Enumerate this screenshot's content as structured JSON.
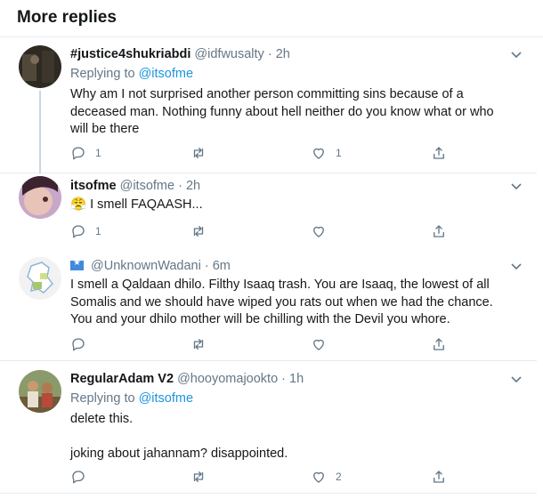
{
  "header": {
    "title": "More replies"
  },
  "replies": [
    {
      "name": "#justice4shukriabdi",
      "handle": "@idfwusalty",
      "time": "2h",
      "replying_prefix": "Replying to",
      "replying_to": "@itsofme",
      "text_lines": [
        "Why am I not surprised another person committing sins because of a",
        "deceased man. Nothing funny about hell neither do you know what or who",
        "will be there"
      ],
      "reply_count": "1",
      "like_count": "1"
    },
    {
      "name": "itsofme",
      "handle": "@itsofme",
      "time": "2h",
      "emoji": "😤",
      "text": "I smell FAQAASH...",
      "reply_count": "1"
    },
    {
      "handle": "@UnknownWadani",
      "time": "6m",
      "text_lines": [
        "I smell a Qaldaan dhilo. Filthy Isaaq trash. You are Isaaq, the lowest of all",
        "Somalis and we should have wiped you rats out when we had the chance.",
        "You and your dhilo mother will be chilling with the Devil you whore."
      ]
    },
    {
      "name": "RegularAdam V2",
      "handle": "@hooyomajookto",
      "time": "1h",
      "replying_prefix": "Replying to",
      "replying_to": "@itsofme",
      "text_line1": "delete this.",
      "text_line2": "joking about jahannam? disappointed.",
      "like_count": "2"
    }
  ],
  "separator": "·",
  "icons": [
    "reply-icon",
    "retweet-icon",
    "like-icon",
    "share-icon",
    "chevron-down-icon"
  ],
  "colors": {
    "link": "#1b95e0",
    "muted": "#657786",
    "border": "#e6ecf0",
    "thread_line": "#ccd6dd"
  }
}
